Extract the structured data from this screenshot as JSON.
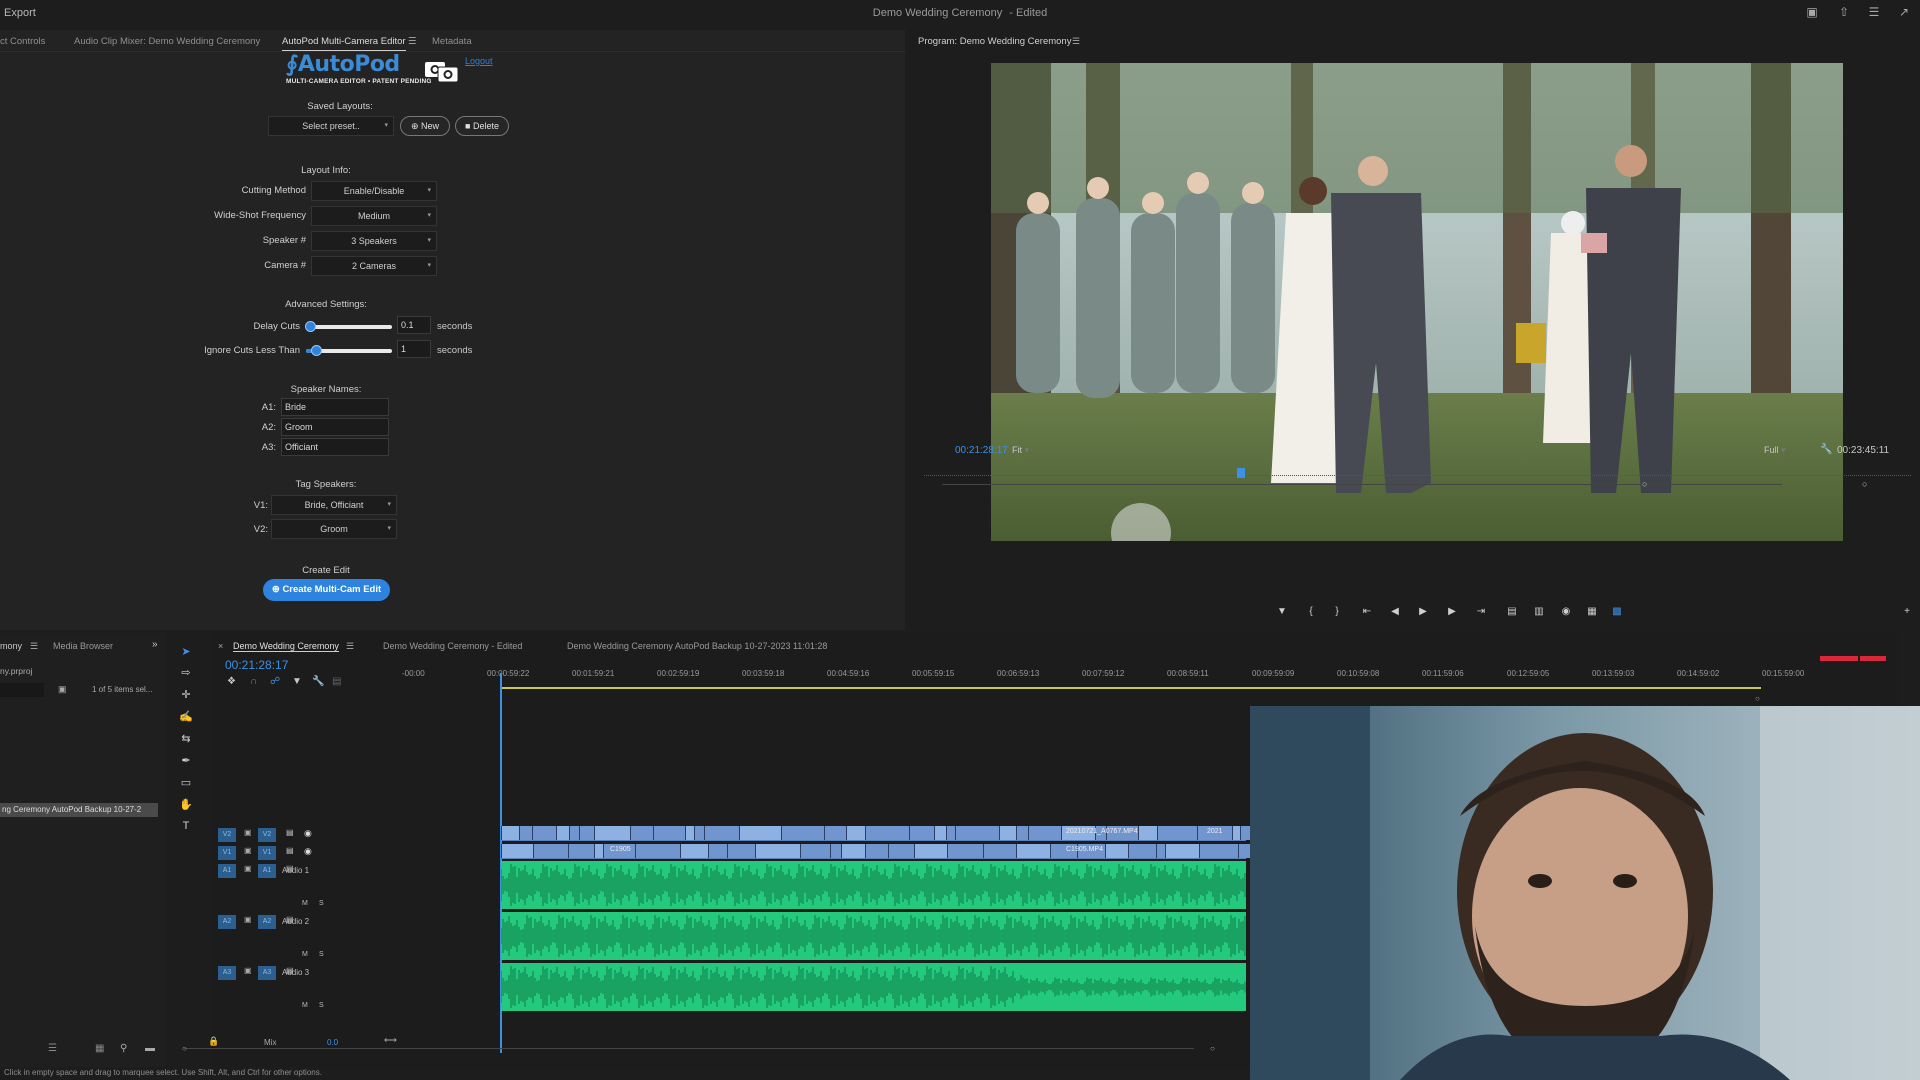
{
  "topbar": {
    "export_label": "Export",
    "title": "Demo Wedding Ceremony",
    "edited": "- Edited"
  },
  "left_tabs": [
    "ct Controls",
    "Audio Clip Mixer: Demo Wedding Ceremony",
    "AutoPod Multi-Camera Editor",
    "Metadata"
  ],
  "autopod": {
    "logo_text": "AutoPod",
    "logo_sub": "MULTI-CAMERA EDITOR • PATENT PENDING",
    "logout": "Logout",
    "saved_layouts_label": "Saved Layouts:",
    "preset_placeholder": "Select preset..",
    "new_button": "New",
    "delete_button": "Delete",
    "layout_info_label": "Layout Info:",
    "fields": [
      {
        "label": "Cutting Method",
        "value": "Enable/Disable"
      },
      {
        "label": "Wide-Shot Frequency",
        "value": "Medium"
      },
      {
        "label": "Speaker #",
        "value": "3 Speakers"
      },
      {
        "label": "Camera #",
        "value": "2 Cameras"
      }
    ],
    "advanced_label": "Advanced Settings:",
    "delay_cuts": {
      "label": "Delay Cuts",
      "value": "0.1",
      "unit": "seconds",
      "level": 0.05
    },
    "ignore_cuts": {
      "label": "Ignore Cuts Less Than",
      "value": "1",
      "unit": "seconds",
      "level": 0.12
    },
    "speaker_names_label": "Speaker Names:",
    "speakers": [
      {
        "id": "A1:",
        "name": "Bride"
      },
      {
        "id": "A2:",
        "name": "Groom"
      },
      {
        "id": "A3:",
        "name": "Officiant"
      }
    ],
    "tag_speakers_label": "Tag Speakers:",
    "tags": [
      {
        "id": "V1:",
        "value": "Bride, Officiant"
      },
      {
        "id": "V2:",
        "value": "Groom"
      }
    ],
    "create_edit_label": "Create Edit",
    "create_button": "Create Multi-Cam Edit"
  },
  "program": {
    "title": "Program: Demo Wedding Ceremony",
    "timecode": "00:21:28:17",
    "fit": "Fit",
    "quality": "Full",
    "duration": "00:23:45:11"
  },
  "project": {
    "tab1": "mony",
    "tab2": "Media Browser",
    "file": "ny.prproj",
    "items_count": "1 of 5 items sel...",
    "selected_item": "ng Ceremony AutoPod Backup 10-27-2"
  },
  "timeline": {
    "tabs": [
      "Demo Wedding Ceremony",
      "Demo Wedding Ceremony - Edited",
      "Demo Wedding Ceremony AutoPod Backup 10-27-2023 11:01:28"
    ],
    "timecode": "00:21:28:17",
    "ruler": [
      "-00:00",
      "00:00:59:22",
      "00:01:59:21",
      "00:02:59:19",
      "00:03:59:18",
      "00:04:59:16",
      "00:05:59:15",
      "00:06:59:13",
      "00:07:59:12",
      "00:08:59:11",
      "00:09:59:09",
      "00:10:59:08",
      "00:11:59:06",
      "00:12:59:05",
      "00:13:59:03",
      "00:14:59:02",
      "00:15:59:00"
    ],
    "tracks": [
      {
        "src": "V2",
        "name": "V2"
      },
      {
        "src": "V1",
        "name": "V1"
      },
      {
        "src": "A1",
        "name": "A1",
        "label": "Audio 1"
      },
      {
        "src": "A2",
        "name": "A2",
        "label": "Audio 2"
      },
      {
        "src": "A3",
        "name": "A3",
        "label": "Audio 3"
      }
    ],
    "clip_name_a": "20210721_A0767.MP4",
    "clip_name_b": "C1905.MP4",
    "clip_name_c": "C1905",
    "clip_name_d": "2021",
    "mix_label": "Mix",
    "mix_value": "0.0",
    "track_buttons": {
      "m": "M",
      "s": "S"
    }
  },
  "status": "Click in empty space and drag to marquee select. Use Shift, Alt, and Ctrl for other options.",
  "colors": {
    "accent": "#2d83de",
    "audio_wave": "#23c97c",
    "video_clip": "#7da0d8"
  }
}
